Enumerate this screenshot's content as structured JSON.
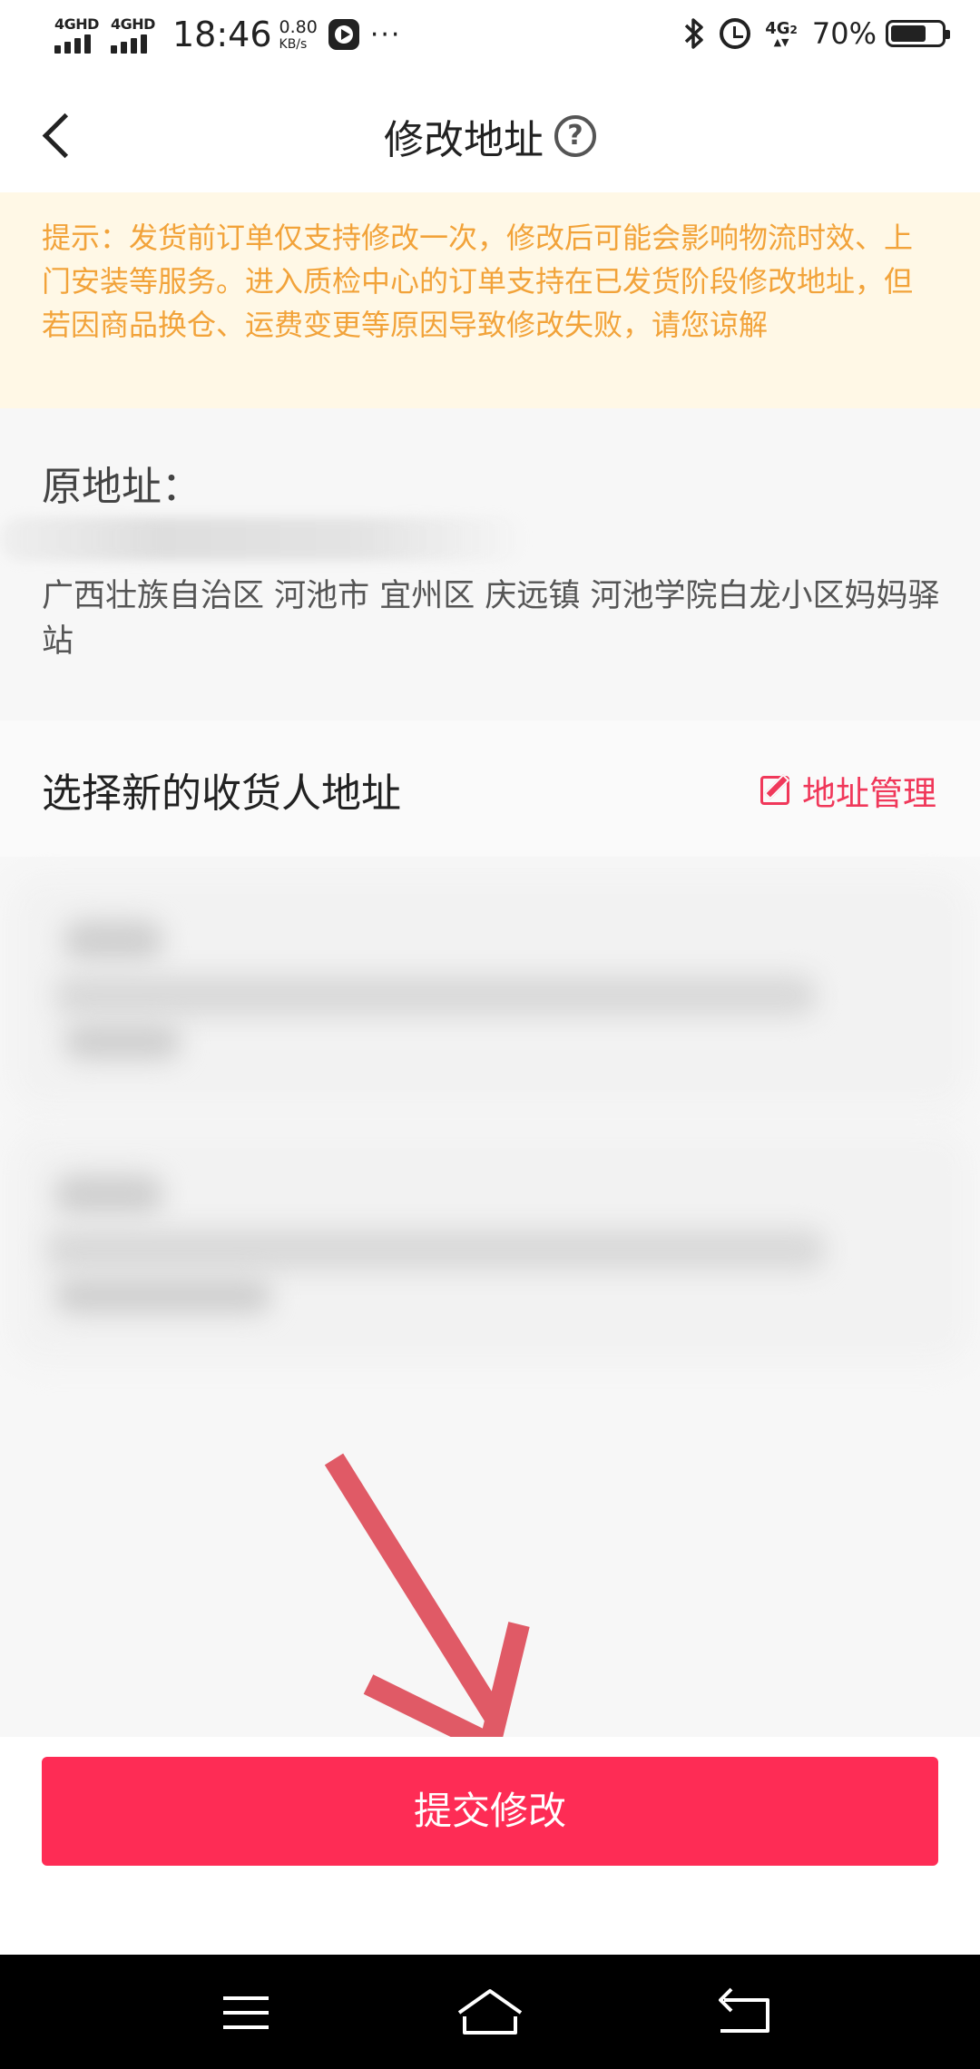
{
  "status_bar": {
    "network_1": "4GHD",
    "network_2": "4GHD",
    "time": "18:46",
    "speed_value": "0.80",
    "speed_unit": "KB/s",
    "more": "···",
    "network_right": "4G",
    "network_right_sub": "2",
    "battery_text": "70%",
    "battery_level": 0.7,
    "icons": [
      "signal-icon",
      "play-icon",
      "bluetooth-icon",
      "alarm-icon",
      "battery-icon"
    ]
  },
  "header": {
    "title": "修改地址",
    "help_symbol": "?"
  },
  "notice": {
    "text": "提示：发货前订单仅支持修改一次，修改后可能会影响物流时效、上门安装等服务。进入质检中心的订单支持在已发货阶段修改地址，但若因商品换仓、运费变更等原因导致修改失败，请您谅解"
  },
  "original": {
    "label": "原地址：",
    "address": "广西壮族自治区 河池市 宜州区 庆远镇 河池学院白龙小区妈妈驿站"
  },
  "new_address": {
    "title": "选择新的收货人地址",
    "manage_label": "地址管理"
  },
  "footer": {
    "submit_label": "提交修改"
  },
  "colors": {
    "accent": "#fe2c55",
    "manage": "#f0385a",
    "notice_text": "#f2a33a",
    "notice_bg": "#fff8e6",
    "arrow": "#e05a66"
  }
}
